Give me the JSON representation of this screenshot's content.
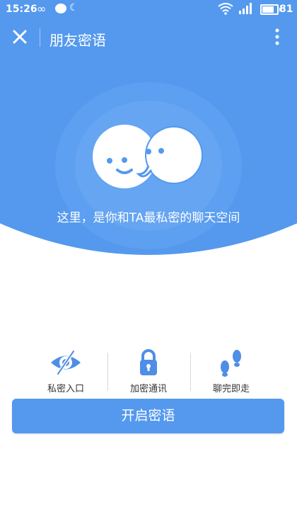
{
  "status_bar": {
    "time": "15:26",
    "battery": "81"
  },
  "header": {
    "title": "朋友密语"
  },
  "hero": {
    "tagline": "这里，是你和TA最私密的聊天空间"
  },
  "features": [
    {
      "label": "私密入口",
      "icon": "hidden-eye-icon"
    },
    {
      "label": "加密通讯",
      "icon": "lock-icon"
    },
    {
      "label": "聊完即走",
      "icon": "footprints-icon"
    }
  ],
  "action": {
    "start_label": "开启密语"
  },
  "colors": {
    "accent": "#5499ee",
    "ring_outer": "#5d9ff0",
    "ring_inner": "#66a5f1"
  }
}
